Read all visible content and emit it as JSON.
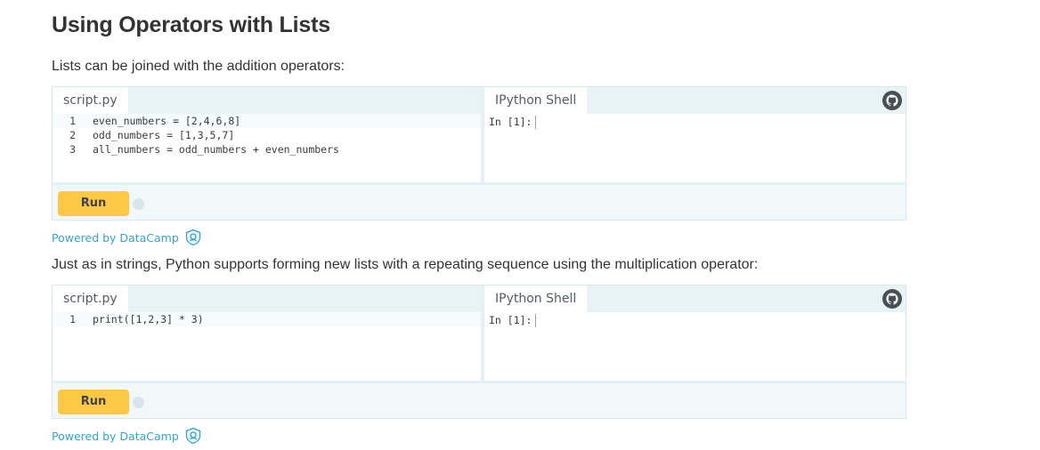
{
  "page": {
    "title": "Using Operators with Lists",
    "intro_paragraph": "Lists can be joined with the addition operators:",
    "second_paragraph": "Just as in strings, Python supports forming new lists with a repeating sequence using the multiplication operator:"
  },
  "widgets": [
    {
      "editor_tab": "script.py",
      "shell_tab": "IPython Shell",
      "shell_prompt": "In [1]:",
      "run_label": "Run",
      "powered_by": "Powered by DataCamp",
      "code_lines": [
        {
          "num": "1",
          "text": "even_numbers = [2,4,6,8]"
        },
        {
          "num": "2",
          "text": "odd_numbers = [1,3,5,7]"
        },
        {
          "num": "3",
          "text": "all_numbers = odd_numbers + even_numbers"
        }
      ]
    },
    {
      "editor_tab": "script.py",
      "shell_tab": "IPython Shell",
      "shell_prompt": "In [1]:",
      "run_label": "Run",
      "powered_by": "Powered by DataCamp",
      "code_lines": [
        {
          "num": "1",
          "text": "print([1,2,3] * 3)"
        }
      ]
    }
  ],
  "icons": {
    "github": "github-icon",
    "datacamp": "datacamp-logo-icon"
  },
  "colors": {
    "run_button": "#ffc844",
    "link": "#3ba2c6",
    "tab_bar": "#e8f3f6",
    "keyword": "#2b4fd6"
  }
}
